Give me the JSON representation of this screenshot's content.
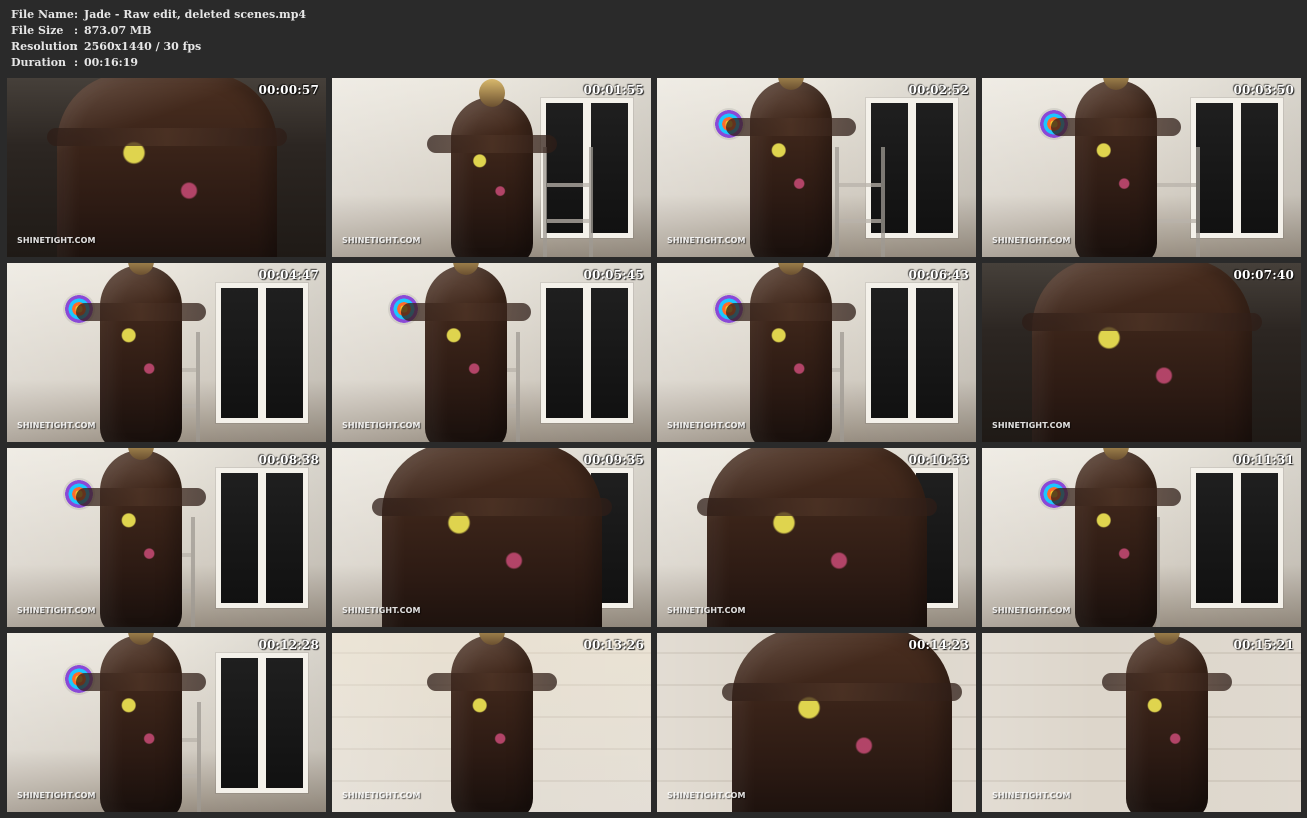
{
  "file_info": {
    "file_name_label": "File Name",
    "file_name_value": "Jade - Raw edit, deleted scenes.mp4",
    "file_size_label": "File Size",
    "file_size_value": "873.07 MB",
    "resolution_label": "Resolution",
    "resolution_value": "2560x1440 / 30 fps",
    "duration_label": "Duration",
    "duration_value": "00:16:19",
    "separator": ":"
  },
  "thumbnails": [
    {
      "time": "00:00:57",
      "watermark": "SHINETIGHT.COM"
    },
    {
      "time": "00:01:55",
      "watermark": "SHINETIGHT.COM"
    },
    {
      "time": "00:02:52",
      "watermark": "SHINETIGHT.COM"
    },
    {
      "time": "00:03:50",
      "watermark": "SHINETIGHT.COM"
    },
    {
      "time": "00:04:47",
      "watermark": "SHINETIGHT.COM"
    },
    {
      "time": "00:05:45",
      "watermark": "SHINETIGHT.COM"
    },
    {
      "time": "00:06:43",
      "watermark": "SHINETIGHT.COM"
    },
    {
      "time": "00:07:40",
      "watermark": "SHINETIGHT.COM"
    },
    {
      "time": "00:08:38",
      "watermark": "SHINETIGHT.COM"
    },
    {
      "time": "00:09:35",
      "watermark": "SHINETIGHT.COM"
    },
    {
      "time": "00:10:33",
      "watermark": "SHINETIGHT.COM"
    },
    {
      "time": "00:11:31",
      "watermark": "SHINETIGHT.COM"
    },
    {
      "time": "00:12:28",
      "watermark": "SHINETIGHT.COM"
    },
    {
      "time": "00:13:26",
      "watermark": "SHINETIGHT.COM"
    },
    {
      "time": "00:14:23",
      "watermark": "SHINETIGHT.COM"
    },
    {
      "time": "00:15:21",
      "watermark": "SHINETIGHT.COM"
    }
  ]
}
